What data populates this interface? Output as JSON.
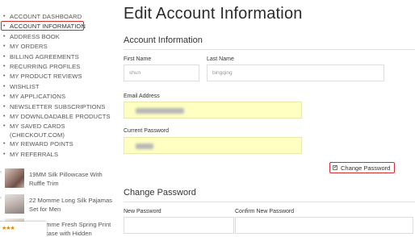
{
  "sidebar": {
    "items": [
      {
        "label": "ACCOUNT DASHBOARD"
      },
      {
        "label": "ACCOUNT INFORMATION"
      },
      {
        "label": "ADDRESS BOOK"
      },
      {
        "label": "MY ORDERS"
      },
      {
        "label": "BILLING AGREEMENTS"
      },
      {
        "label": "RECURRING PROFILES"
      },
      {
        "label": "MY PRODUCT REVIEWS"
      },
      {
        "label": "WISHLIST"
      },
      {
        "label": "MY APPLICATIONS"
      },
      {
        "label": "NEWSLETTER SUBSCRIPTIONS"
      },
      {
        "label": "MY DOWNLOADABLE PRODUCTS"
      },
      {
        "label": "MY SAVED CARDS (CHECKOUT.COM)"
      },
      {
        "label": "MY REWARD POINTS"
      },
      {
        "label": "MY REFERRALS"
      }
    ],
    "active_index": 1,
    "products": [
      {
        "name": "19MM Silk Pillowcase With Ruffle Trim"
      },
      {
        "name": "22 Momme Long Silk Pajamas Set for Men"
      },
      {
        "name": "22 Momme Fresh Spring Print Pillowcase with Hidden"
      }
    ],
    "rating_stars": "★★★"
  },
  "main": {
    "page_title": "Edit Account Information",
    "account_section_title": "Account Information",
    "first_name_label": "First Name",
    "first_name_value": "shun",
    "last_name_label": "Last Name",
    "last_name_value": "bingqing",
    "email_label": "Email Address",
    "current_password_label": "Current Password",
    "change_password_checkbox_label": "Change Password",
    "change_password_checked": true,
    "change_section_title": "Change Password",
    "new_password_label": "New Password",
    "confirm_password_label": "Confirm New Password"
  },
  "colors": {
    "highlight_border": "#d32f2f",
    "autofill_bg": "#ffffc2"
  }
}
